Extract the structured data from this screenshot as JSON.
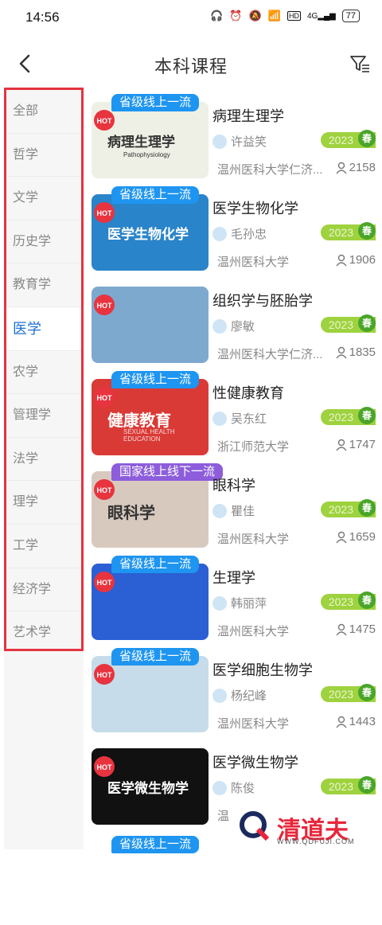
{
  "status": {
    "time": "14:56",
    "icons": [
      "headphones-icon",
      "alarm-icon",
      "mute-icon",
      "wifi-icon",
      "hd-icon",
      "4g-signal-icon"
    ],
    "battery": "77"
  },
  "header": {
    "title": "本科课程"
  },
  "sidebar": {
    "items": [
      {
        "label": "全部"
      },
      {
        "label": "哲学"
      },
      {
        "label": "文学"
      },
      {
        "label": "历史学"
      },
      {
        "label": "教育学"
      },
      {
        "label": "医学",
        "active": true
      },
      {
        "label": "农学"
      },
      {
        "label": "管理学"
      },
      {
        "label": "法学"
      },
      {
        "label": "理学"
      },
      {
        "label": "工学"
      },
      {
        "label": "经济学"
      },
      {
        "label": "艺术学"
      }
    ]
  },
  "hot_label": "HOT",
  "courses": [
    {
      "tag": "省级线上一流",
      "tag_color": "#1e95f0",
      "title": "病理生理学",
      "teacher": "许益笑",
      "year": "2023",
      "term": "春",
      "school": "温州医科大学仁济...",
      "learners": "2158",
      "thumb_text": "病理生理学",
      "thumb_sub": "Pathophysiology",
      "bg": "#eef0e6"
    },
    {
      "tag": "省级线上一流",
      "tag_color": "#1e95f0",
      "title": "医学生物化学",
      "teacher": "毛孙忠",
      "year": "2023",
      "term": "春",
      "school": "温州医科大学",
      "learners": "1906",
      "thumb_text": "医学生物化学",
      "thumb_sub": "",
      "bg": "#2a84c9"
    },
    {
      "tag": "",
      "tag_color": "",
      "title": "组织学与胚胎学",
      "teacher": "廖敏",
      "year": "2023",
      "term": "春",
      "school": "温州医科大学仁济...",
      "learners": "1835",
      "thumb_text": "",
      "thumb_sub": "",
      "bg": "#7ea9cf"
    },
    {
      "tag": "省级线上一流",
      "tag_color": "#1e95f0",
      "title": "性健康教育",
      "teacher": "吴东红",
      "year": "2023",
      "term": "春",
      "school": "浙江师范大学",
      "learners": "1747",
      "thumb_text": "健康教育",
      "thumb_sub": "SEXUAL HEALTH EDUCATION",
      "bg": "#d93a36"
    },
    {
      "tag": "国家线上线下一流",
      "tag_color": "#8d5ddb",
      "title": "眼科学",
      "teacher": "瞿佳",
      "year": "2023",
      "term": "春",
      "school": "温州医科大学",
      "learners": "1659",
      "thumb_text": "眼科学",
      "thumb_sub": "",
      "bg": "#d8c9bf"
    },
    {
      "tag": "省级线上一流",
      "tag_color": "#1e95f0",
      "title": "生理学",
      "teacher": "韩丽萍",
      "year": "2023",
      "term": "春",
      "school": "温州医科大学",
      "learners": "1475",
      "thumb_text": "",
      "thumb_sub": "",
      "bg": "#2b5fd4"
    },
    {
      "tag": "省级线上一流",
      "tag_color": "#1e95f0",
      "title": "医学细胞生物学",
      "teacher": "杨纪峰",
      "year": "2023",
      "term": "春",
      "school": "温州医科大学",
      "learners": "1443",
      "thumb_text": "",
      "thumb_sub": "",
      "bg": "#c6dcea"
    },
    {
      "tag": "",
      "tag_color": "",
      "title": "医学微生物学",
      "teacher": "陈俊",
      "year": "2023",
      "term": "春",
      "school": "温",
      "learners": "",
      "thumb_text": "医学微生物学",
      "thumb_sub": "",
      "bg": "#111111"
    }
  ],
  "partial_card": {
    "tag": "省级线上一流"
  },
  "watermark": {
    "text": "清道夫",
    "sub": "WWW.QDFUJI.COM"
  }
}
